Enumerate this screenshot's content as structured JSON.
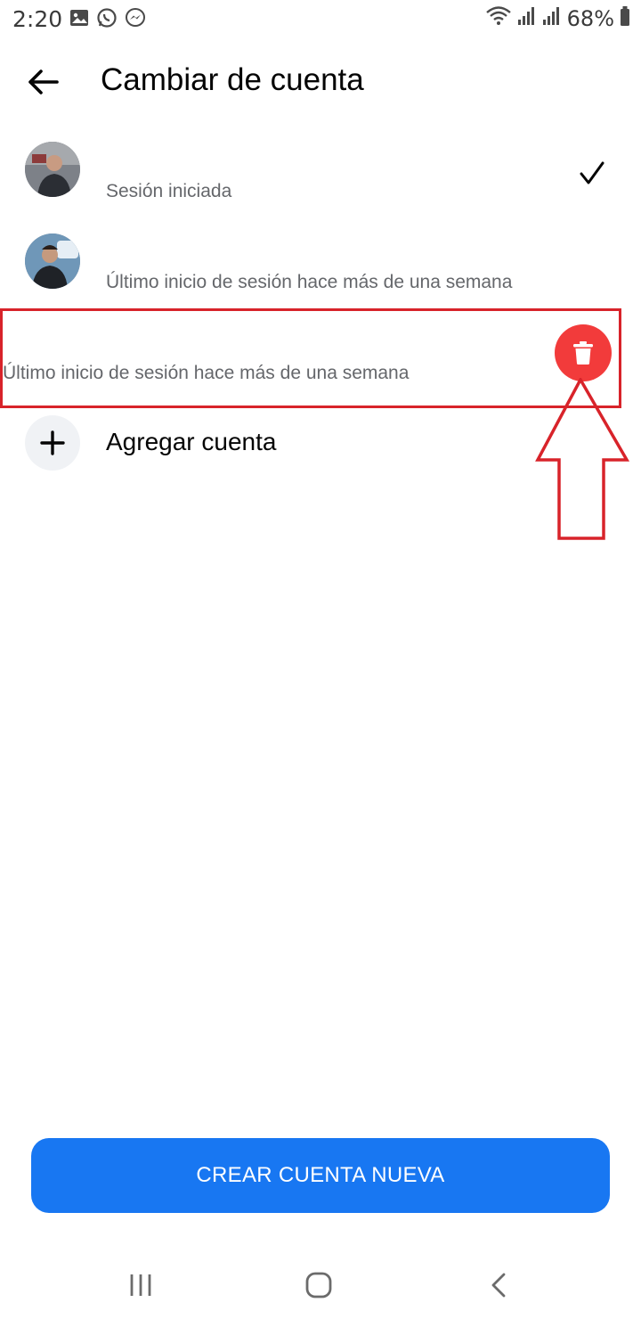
{
  "status_bar": {
    "time": "2:20",
    "left_icons": [
      "image-icon",
      "whatsapp-icon",
      "messenger-icon"
    ],
    "right_icons": [
      "wifi-icon",
      "signal-icon",
      "signal-icon"
    ],
    "battery": "68%"
  },
  "header": {
    "title": "Cambiar de cuenta"
  },
  "accounts": [
    {
      "name": "",
      "status": "Sesión iniciada",
      "selected": true
    },
    {
      "name": "",
      "status": "Último inicio de sesión hace más de una semana",
      "selected": false
    },
    {
      "name": "",
      "status": "Último inicio de sesión hace más de una semana",
      "selected": false,
      "swiped": true
    }
  ],
  "add_account": {
    "label": "Agregar cuenta"
  },
  "create_button": {
    "label": "CREAR CUENTA NUEVA"
  },
  "colors": {
    "accent": "#1877f2",
    "delete": "#f23b3b",
    "annotation": "#d8232a",
    "subtext": "#65676b"
  }
}
